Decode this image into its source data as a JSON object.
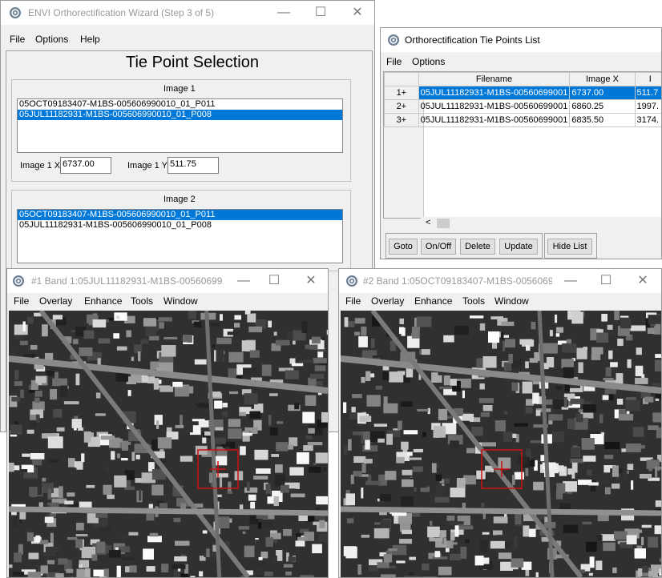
{
  "wizard": {
    "title": "ENVI Orthorectification Wizard (Step 3 of 5)",
    "menu": [
      "File",
      "Options",
      "Help"
    ],
    "heading": "Tie Point Selection",
    "image1": {
      "label": "Image 1",
      "items": [
        "05OCT09183407-M1BS-005606990010_01_P011",
        "05JUL11182931-M1BS-005606990010_01_P008"
      ],
      "selected_index": 1,
      "x_label": "Image 1 X",
      "x_value": "6737.00",
      "y_label": "Image 1 Y",
      "y_value": "511.75"
    },
    "image2": {
      "label": "Image 2",
      "items": [
        "05OCT09183407-M1BS-005606990010_01_P011",
        "05JUL11182931-M1BS-005606990010_01_P008"
      ],
      "selected_index": 0
    }
  },
  "tie_points": {
    "title": "Orthorectification Tie Points List",
    "menu": [
      "File",
      "Options"
    ],
    "columns": [
      "Filename",
      "Image X",
      "I"
    ],
    "rows": [
      {
        "id": "1+",
        "filename": "05JUL11182931-M1BS-00560699001",
        "x": "6737.00",
        "y": "511.7"
      },
      {
        "id": "2+",
        "filename": "05JUL11182931-M1BS-00560699001",
        "x": "6860.25",
        "y": "1997."
      },
      {
        "id": "3+",
        "filename": "05JUL11182931-M1BS-00560699001",
        "x": "6835.50",
        "y": "3174."
      }
    ],
    "buttons": {
      "goto": "Goto",
      "onoff": "On/Off",
      "delete": "Delete",
      "update": "Update",
      "hide": "Hide List"
    }
  },
  "band1": {
    "title": "#1 Band 1:05JUL11182931-M1BS-00560699...",
    "menu": [
      "File",
      "Overlay",
      "Enhance",
      "Tools",
      "Window"
    ]
  },
  "band2": {
    "title": "#2 Band 1:05OCT09183407-M1BS-0056069...",
    "menu": [
      "File",
      "Overlay",
      "Enhance",
      "Tools",
      "Window"
    ]
  },
  "colors": {
    "selection": "#0078d7",
    "cursor_box": "#d01010"
  }
}
